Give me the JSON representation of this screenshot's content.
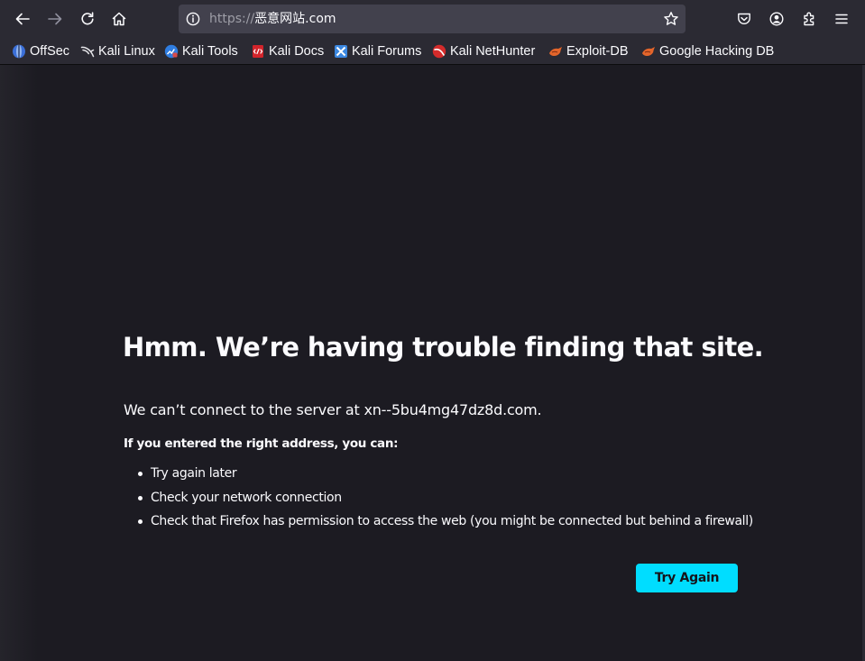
{
  "toolbar": {
    "url_scheme": "https://",
    "url_host": "恶意网站.com",
    "icons": [
      "back-icon",
      "forward-icon",
      "reload-icon",
      "home-icon",
      "site-info-icon",
      "bookmark-star-icon",
      "pocket-icon",
      "account-icon",
      "extensions-icon",
      "menu-icon"
    ]
  },
  "bookmarks": [
    {
      "label": "OffSec",
      "icon": "offsec-icon"
    },
    {
      "label": "Kali Linux",
      "icon": "kali-linux-icon"
    },
    {
      "label": "Kali Tools",
      "icon": "kali-tools-icon"
    },
    {
      "label": "Kali Docs",
      "icon": "kali-docs-icon"
    },
    {
      "label": "Kali Forums",
      "icon": "kali-forums-icon"
    },
    {
      "label": "Kali NetHunter",
      "icon": "kali-nethunter-icon"
    },
    {
      "label": "Exploit-DB",
      "icon": "exploit-db-icon"
    },
    {
      "label": "Google Hacking DB",
      "icon": "ghdb-icon"
    }
  ],
  "error": {
    "title": "Hmm. We’re having trouble finding that site.",
    "description": "We can’t connect to the server at xn--5bu4mg47dz8d.com.",
    "subtitle": "If you entered the right address, you can:",
    "suggestions": [
      "Try again later",
      "Check your network connection",
      "Check that Firefox has permission to access the web (you might be connected but behind a firewall)"
    ],
    "try_again_label": "Try Again"
  },
  "colors": {
    "toolbar_bg": "#2b2a33",
    "urlbar_bg": "#42414d",
    "page_bg": "#1c1b22",
    "accent_button": "#00ddff",
    "text": "#fbfbfe"
  }
}
